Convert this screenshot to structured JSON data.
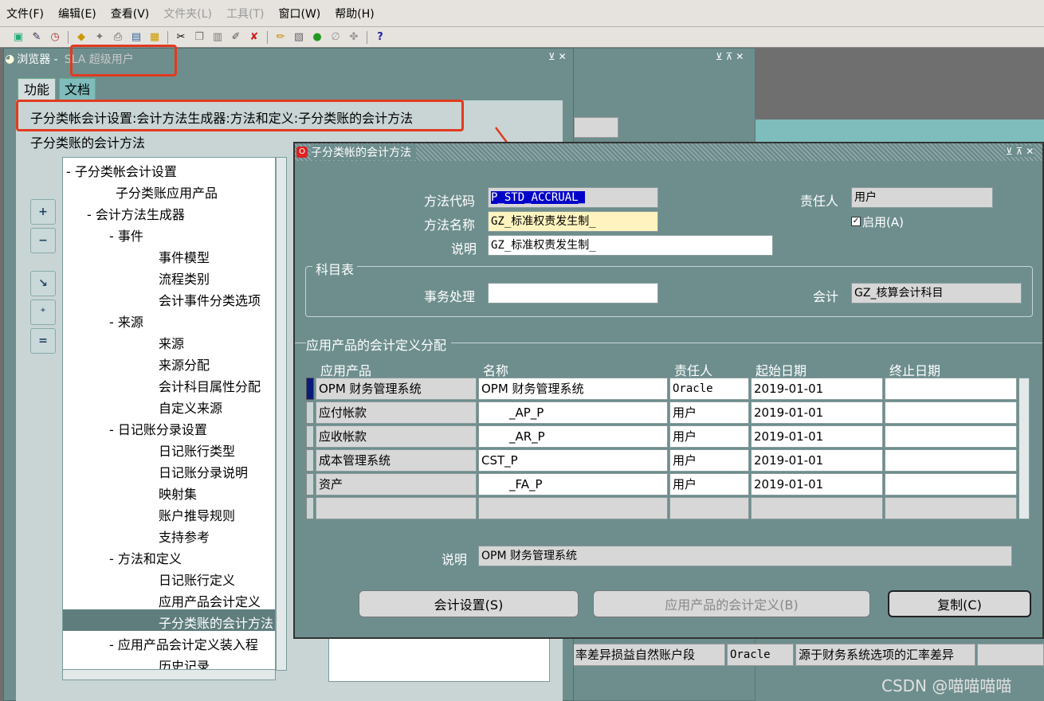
{
  "menubar": {
    "items": [
      "文件(F)",
      "编辑(E)",
      "查看(V)",
      "文件夹(L)",
      "工具(T)",
      "窗口(W)",
      "帮助(H)"
    ]
  },
  "browser": {
    "title": "浏览器 - ",
    "user": "SLA 超级用户",
    "tabs": [
      "功能",
      "文档"
    ],
    "path": "子分类帐会计设置:会计方法生成器:方法和定义:子分类账的会计方法",
    "selected_label": "子分类账的会计方法",
    "tree": [
      {
        "text": "-  子分类帐会计设置"
      },
      {
        "text": "子分类账应用产品"
      },
      {
        "text": "-  会计方法生成器"
      },
      {
        "text": "-  事件"
      },
      {
        "text": "事件模型"
      },
      {
        "text": "流程类别"
      },
      {
        "text": "会计事件分类选项"
      },
      {
        "text": "-  来源"
      },
      {
        "text": "来源"
      },
      {
        "text": "来源分配"
      },
      {
        "text": "会计科目属性分配"
      },
      {
        "text": "自定义来源"
      },
      {
        "text": "-  日记账分录设置"
      },
      {
        "text": "日记账行类型"
      },
      {
        "text": "日记账分录说明"
      },
      {
        "text": "映射集"
      },
      {
        "text": "账户推导规则"
      },
      {
        "text": "支持参考"
      },
      {
        "text": "-  方法和定义"
      },
      {
        "text": "日记账行定义"
      },
      {
        "text": "应用产品会计定义"
      },
      {
        "text": "子分类账的会计方法"
      },
      {
        "text": "-  应用产品会计定义装入程"
      },
      {
        "text": "历史记录"
      }
    ]
  },
  "dialog": {
    "title": "子分类帐的会计方法",
    "labels": {
      "code": "方法代码",
      "name": "方法名称",
      "desc": "说明",
      "owner": "责任人",
      "enabled": "启用(A)",
      "coa_group": "科目表",
      "transaction": "事务处理",
      "accounting": "会计",
      "assign_group": "应用产品的会计定义分配",
      "bottom_desc": "说明"
    },
    "values": {
      "code": "P_STD_ACCRUAL_",
      "name": "GZ_标准权责发生制_",
      "desc": "GZ_标准权责发生制_",
      "owner": "用户",
      "transaction": "",
      "accounting": "GZ_核算会计科目",
      "bottom_desc": "OPM 财务管理系统"
    },
    "columns": [
      "应用产品",
      "名称",
      "责任人",
      "起始日期",
      "终止日期"
    ],
    "rows": [
      [
        "OPM 财务管理系统",
        "OPM 财务管理系统",
        "Oracle",
        "2019-01-01",
        ""
      ],
      [
        "应付帐款",
        "_AP_P",
        "用户",
        "2019-01-01",
        ""
      ],
      [
        "应收帐款",
        "_AR_P",
        "用户",
        "2019-01-01",
        ""
      ],
      [
        "成本管理系统",
        "CST_P",
        "用户",
        "2019-01-01",
        ""
      ],
      [
        "资产",
        "_FA_P",
        "用户",
        "2019-01-01",
        ""
      ]
    ],
    "buttons": {
      "setup": "会计设置(S)",
      "app_def": "应用产品的会计定义(B)",
      "copy": "复制(C)"
    }
  },
  "background_row": {
    "c1": "率差异损益自然账户段",
    "c2": "Oracle",
    "c3": "源于财务系统选项的汇率差异"
  },
  "watermark": "CSDN @喵喵喵喵"
}
